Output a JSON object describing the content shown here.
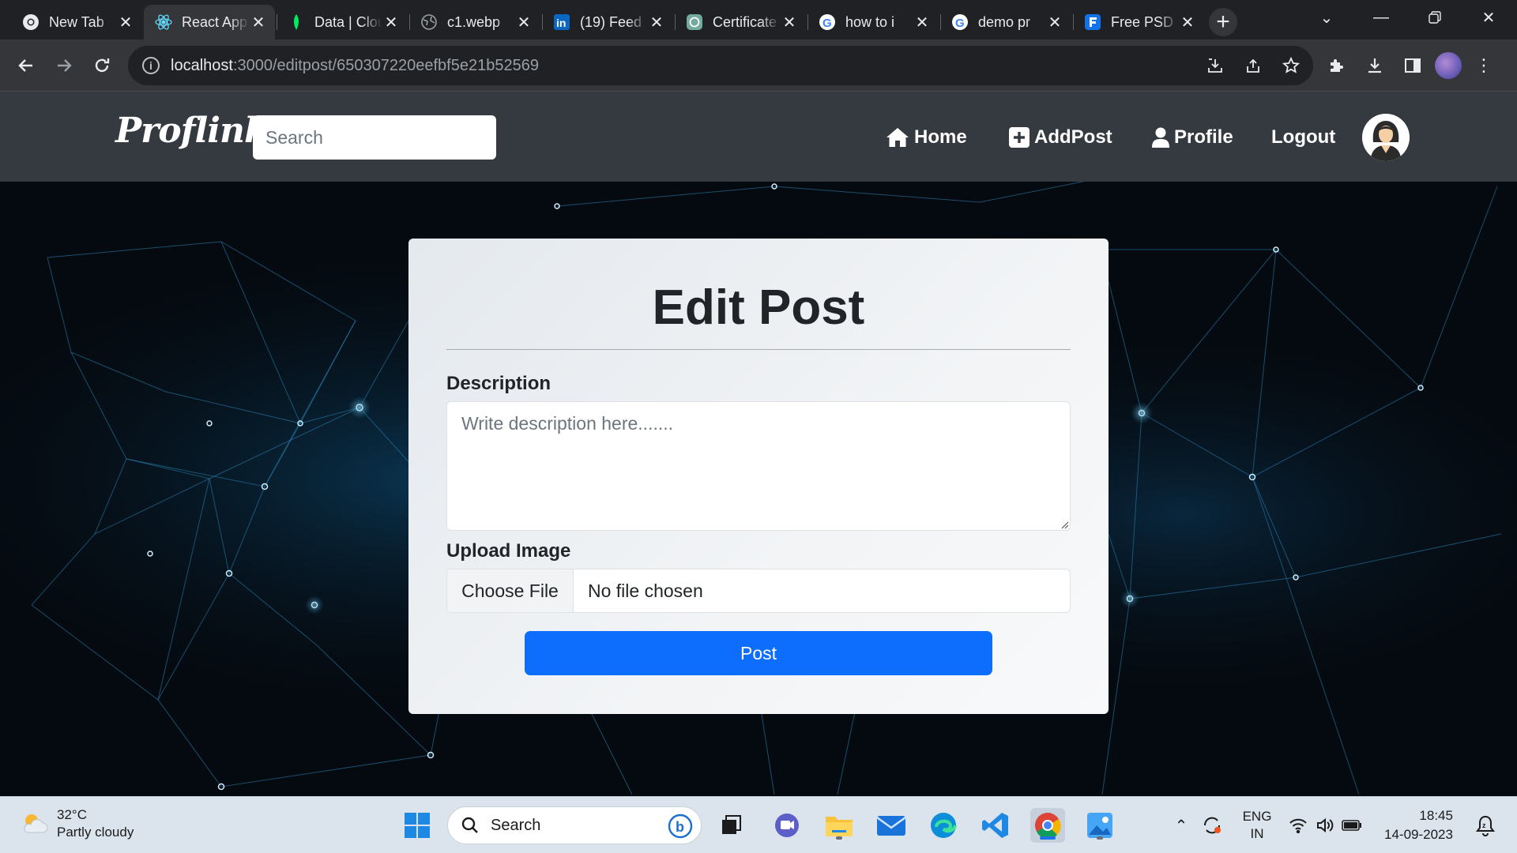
{
  "browser": {
    "tabs": [
      {
        "title": "New Tab",
        "icon": "chrome-icon"
      },
      {
        "title": "React App",
        "icon": "react-icon",
        "active": true
      },
      {
        "title": "Data | Cloud",
        "icon": "mongodb-leaf-icon"
      },
      {
        "title": "c1.webp",
        "icon": "globe-icon"
      },
      {
        "title": "(19) Feed",
        "icon": "linkedin-icon"
      },
      {
        "title": "Certificate",
        "icon": "openai-icon"
      },
      {
        "title": "how to i",
        "icon": "google-icon"
      },
      {
        "title": "demo pr",
        "icon": "google-icon"
      },
      {
        "title": "Free PSD",
        "icon": "freepik-icon"
      }
    ],
    "url_host": "localhost",
    "url_path": ":3000/editpost/650307220eefbf5e21b52569"
  },
  "navbar": {
    "brand": "Proflink",
    "search_placeholder": "Search",
    "links": {
      "home": "Home",
      "addpost": "AddPost",
      "profile": "Profile",
      "logout": "Logout"
    }
  },
  "form": {
    "title": "Edit Post",
    "description_label": "Description",
    "description_placeholder": "Write description here.......",
    "upload_label": "Upload Image",
    "choose_file": "Choose File",
    "no_file": "No file chosen",
    "submit": "Post"
  },
  "taskbar": {
    "temperature": "32°C",
    "weather": "Partly cloudy",
    "search_placeholder": "Search",
    "language": "ENG",
    "region": "IN",
    "time": "18:45",
    "date": "14-09-2023"
  },
  "colors": {
    "navbar_bg": "#343a40",
    "primary": "#0d6efd",
    "page_bg": "#050a10",
    "network_line": "#2a86b8"
  }
}
